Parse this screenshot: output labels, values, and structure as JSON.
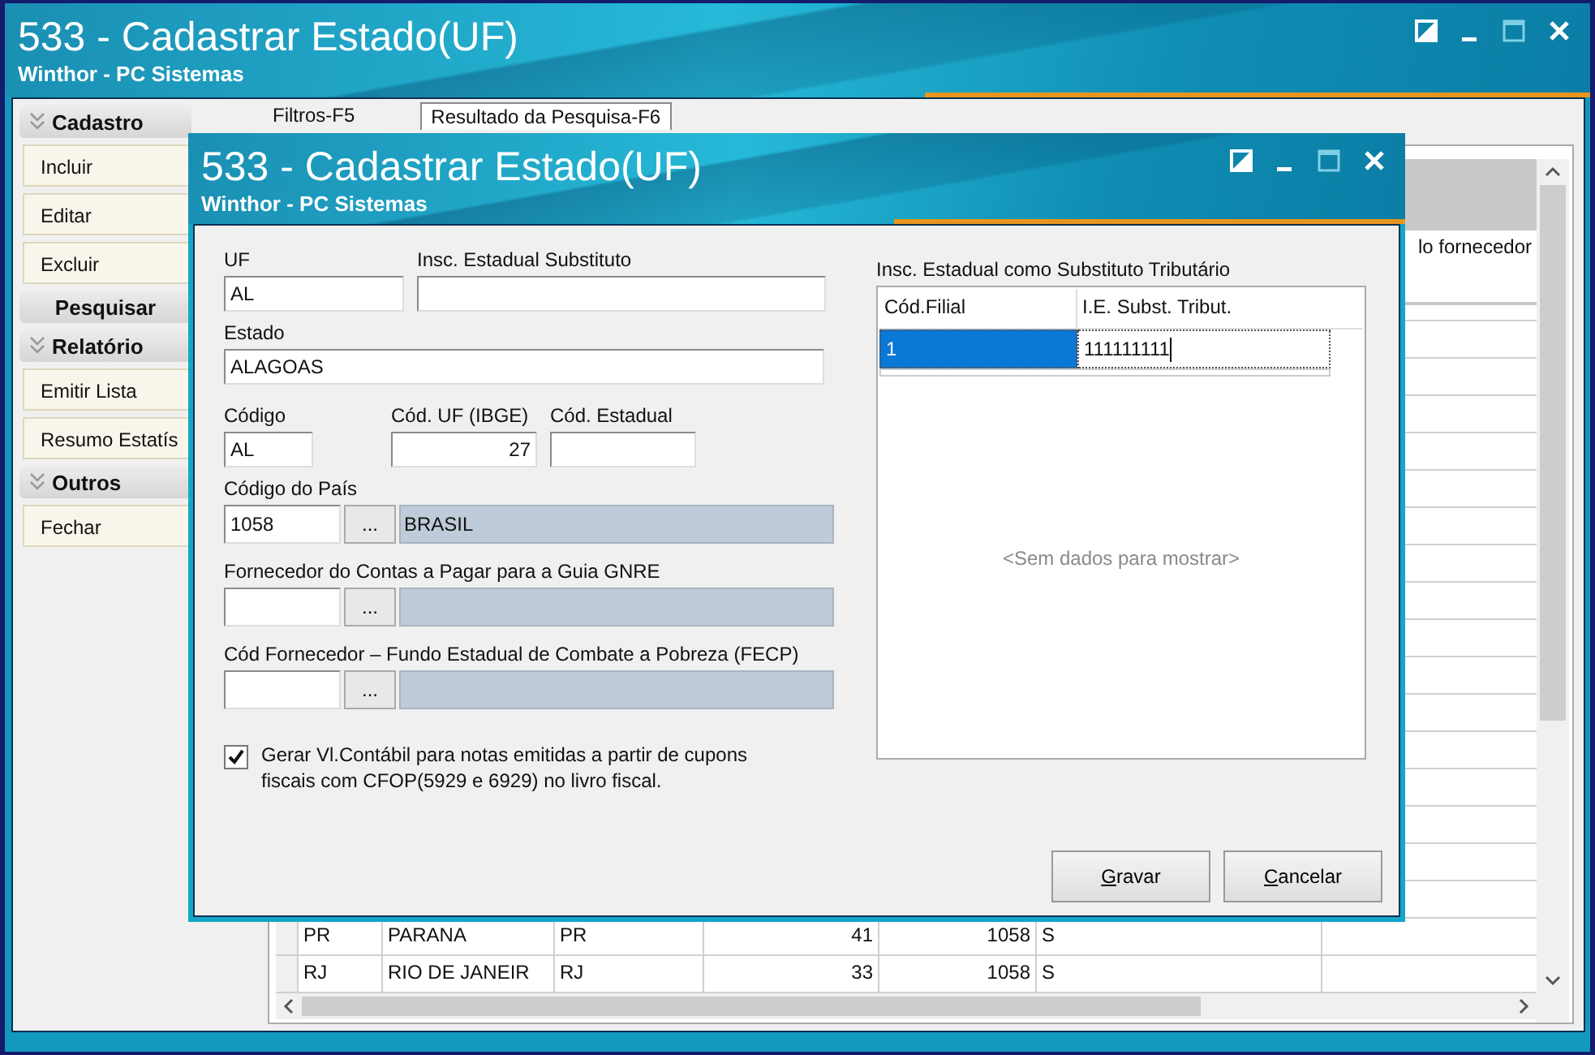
{
  "window": {
    "title": "533 - Cadastrar Estado(UF)",
    "subtitle": "Winthor - PC Sistemas"
  },
  "sidebar": {
    "groups": [
      {
        "title": "Cadastro",
        "collapsible": true,
        "items": [
          "Incluir",
          "Editar",
          "Excluir"
        ]
      },
      {
        "title": "Pesquisar",
        "collapsible": false
      },
      {
        "title": "Relatório",
        "collapsible": true,
        "items": [
          "Emitir Lista",
          "Resumo Estatís"
        ]
      },
      {
        "title": "Outros",
        "collapsible": true,
        "items": [
          "Fechar"
        ]
      }
    ]
  },
  "tabs": [
    {
      "label": "Filtros-F5",
      "selected": false
    },
    {
      "label": "Resultado da Pesquisa-F6",
      "selected": true
    }
  ],
  "grid": {
    "header_fragment": "lo fornecedor",
    "rows": [
      {
        "cells": [
          "PR",
          "PARANA",
          "PR",
          "41",
          "1058",
          "S"
        ]
      },
      {
        "cells": [
          "RJ",
          "RIO DE JANEIR",
          "RJ",
          "33",
          "1058",
          "S"
        ]
      }
    ]
  },
  "dialog": {
    "title": "533 - Cadastrar Estado(UF)",
    "subtitle": "Winthor - PC Sistemas",
    "uf": {
      "label": "UF",
      "value": "AL"
    },
    "insc_substituto": {
      "label": "Insc. Estadual Substituto"
    },
    "estado": {
      "label": "Estado",
      "value": "ALAGOAS"
    },
    "codigo": {
      "label": "Código",
      "value": "AL"
    },
    "cod_uf_ibge": {
      "label": "Cód. UF (IBGE)",
      "value": "27"
    },
    "cod_estadual": {
      "label": "Cód. Estadual"
    },
    "lookups": [
      {
        "label": "Código do País",
        "value": "1058",
        "button": "...",
        "description": "BRASIL"
      },
      {
        "label": "Fornecedor do Contas a Pagar para a Guia GNRE",
        "button": "..."
      },
      {
        "label": "Cód Fornecedor – Fundo Estadual de Combate a Pobreza (FECP)",
        "button": "..."
      }
    ],
    "gerar_checkbox": {
      "label": "Gerar Vl.Contábil para notas emitidas a partir de cupons fiscais com CFOP(5929 e 6929) no livro fiscal.",
      "checked": true
    },
    "ie_grid": {
      "title": "Insc. Estadual como Substituto Tributário",
      "columns": [
        "Cód.Filial",
        "I.E. Subst. Tribut."
      ],
      "rows": [
        {
          "cells": [
            "1",
            "111111111"
          ],
          "selected": true
        }
      ],
      "empty_text": "<Sem dados para mostrar>"
    },
    "buttons": [
      "Gravar",
      "Cancelar"
    ]
  }
}
